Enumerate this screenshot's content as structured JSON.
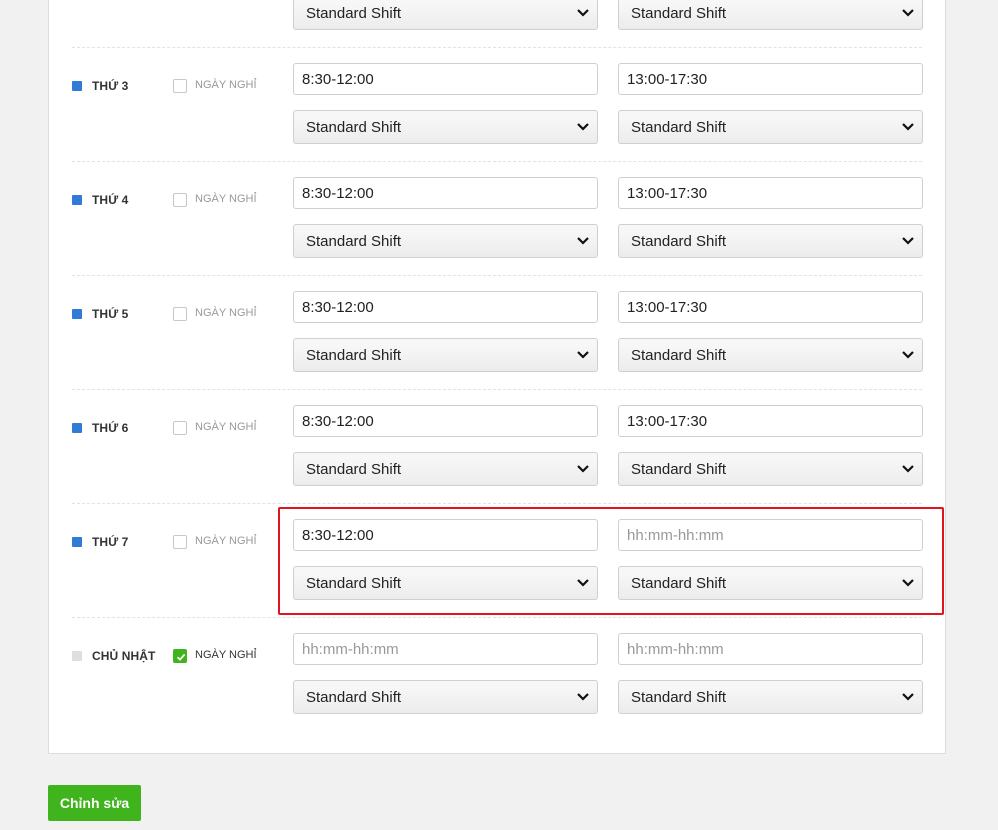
{
  "placeholder_time": "hh:mm-hh:mm",
  "shift_default": "Standard Shift",
  "days_off_label": "NGÀY NGHỈ",
  "top_row": {
    "shift1": "Standard Shift",
    "shift2": "Standard Shift"
  },
  "days": [
    {
      "name": "THỨ 3",
      "active": true,
      "day_off": false,
      "time1": "8:30-12:00",
      "time2": "13:00-17:30",
      "shift1": "Standard Shift",
      "shift2": "Standard Shift"
    },
    {
      "name": "THỨ 4",
      "active": true,
      "day_off": false,
      "time1": "8:30-12:00",
      "time2": "13:00-17:30",
      "shift1": "Standard Shift",
      "shift2": "Standard Shift"
    },
    {
      "name": "THỨ 5",
      "active": true,
      "day_off": false,
      "time1": "8:30-12:00",
      "time2": "13:00-17:30",
      "shift1": "Standard Shift",
      "shift2": "Standard Shift"
    },
    {
      "name": "THỨ 6",
      "active": true,
      "day_off": false,
      "time1": "8:30-12:00",
      "time2": "13:00-17:30",
      "shift1": "Standard Shift",
      "shift2": "Standard Shift"
    },
    {
      "name": "THỨ 7",
      "active": true,
      "day_off": false,
      "time1": "8:30-12:00",
      "time2": "",
      "shift1": "Standard Shift",
      "shift2": "Standard Shift"
    },
    {
      "name": "CHỦ NHẬT",
      "active": false,
      "day_off": true,
      "time1": "",
      "time2": "",
      "shift1": "Standard Shift",
      "shift2": "Standard Shift"
    }
  ],
  "edit_button": "Chỉnh sửa",
  "colors": {
    "active_dot": "#2f7bd6",
    "inactive_dot": "#dedede",
    "accent_green": "#3fb41c",
    "highlight_red": "#e0141c"
  }
}
